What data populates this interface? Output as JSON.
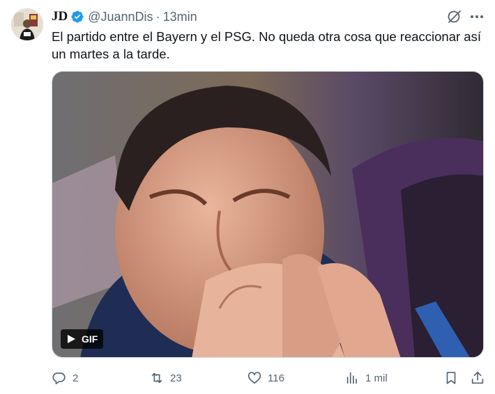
{
  "tweet": {
    "author_name": "JD",
    "handle": "@JuannDis",
    "separator": "·",
    "time": "13min",
    "text": "El partido entre el Bayern y el PSG. No queda otra cosa que reaccionar así un martes a la tarde.",
    "media": {
      "badge": "GIF",
      "icon": "play-icon"
    }
  },
  "actions": {
    "replies": "2",
    "reposts": "23",
    "likes": "116",
    "views": "1 mil"
  },
  "colors": {
    "text_primary": "#0f1419",
    "text_secondary": "#536471",
    "verified": "#1d9bf0",
    "border": "#cfd9de"
  },
  "icons": [
    "verified-badge-icon",
    "grok-icon",
    "more-icon",
    "reply-icon",
    "repost-icon",
    "like-icon",
    "views-icon",
    "bookmark-icon",
    "share-icon"
  ]
}
